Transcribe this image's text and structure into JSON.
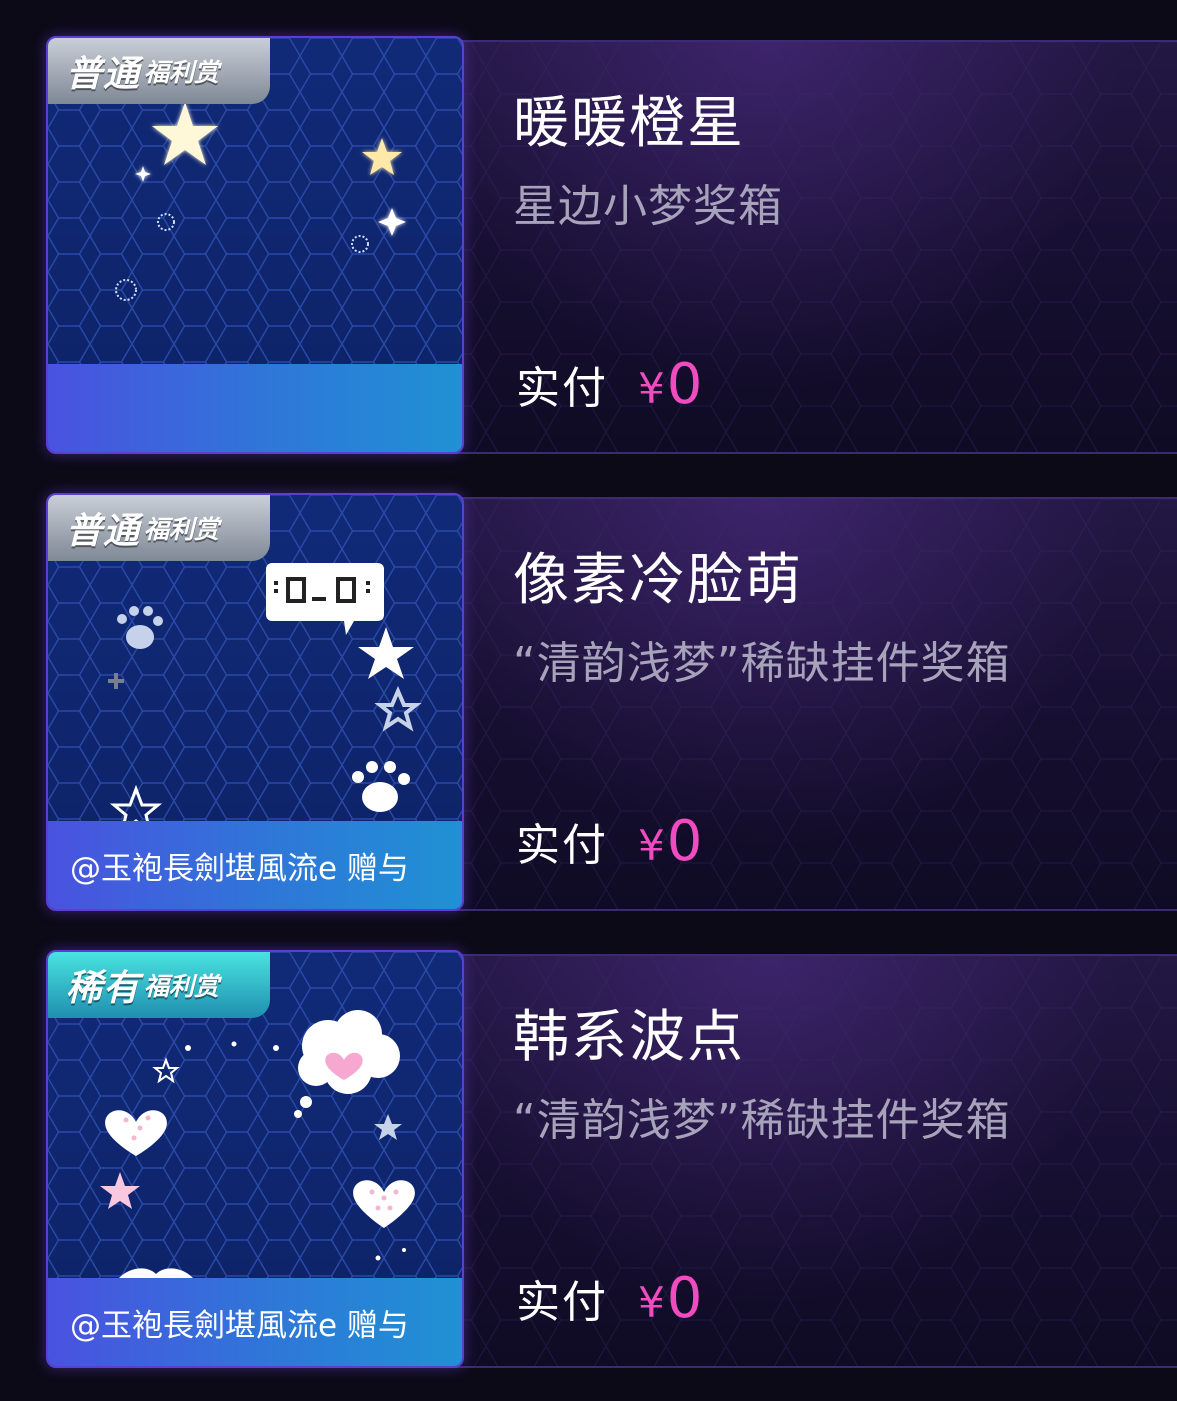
{
  "items": [
    {
      "tier": "普通",
      "tag": "福利赏",
      "title": "暖暖橙星",
      "subtitle": "星边小梦奖箱",
      "gift_from": "",
      "pay_label": "实付",
      "currency": "¥",
      "amount": "0"
    },
    {
      "tier": "普通",
      "tag": "福利赏",
      "title": "像素冷脸萌",
      "subtitle": "“清韵浅梦”稀缺挂件奖箱",
      "gift_from": "@玉袍長劍堪風流e 赠与",
      "pay_label": "实付",
      "currency": "¥",
      "amount": "0"
    },
    {
      "tier": "稀有",
      "tag": "福利赏",
      "title": "韩系波点",
      "subtitle": "“清韵浅梦”稀缺挂件奖箱",
      "gift_from": "@玉袍長劍堪風流e 赠与",
      "pay_label": "实付",
      "currency": "¥",
      "amount": "0"
    }
  ],
  "colors": {
    "background": "#0c0a17",
    "price": "#f04bbf",
    "badge_common": "#9aa2ae",
    "badge_rare": "#2fbfd0",
    "gift_bar": "#3a6fdc"
  }
}
